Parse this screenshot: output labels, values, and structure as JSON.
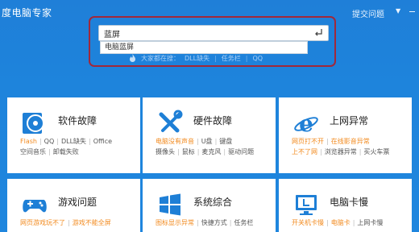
{
  "header": {
    "app_title": "度电脑专家",
    "feedback": "提交问题",
    "menu_arrow": "▼"
  },
  "search": {
    "value": "蓝屏",
    "suggestion": "电脑蓝屏",
    "hot_label": "大家都在搜：",
    "hot_items": [
      "DLL缺失",
      "任务栏",
      "QQ"
    ]
  },
  "cards": [
    {
      "title": "软件故障",
      "icon": "disc-icon",
      "lines": [
        [
          {
            "t": "Flash",
            "hot": true
          },
          {
            "t": "QQ"
          },
          {
            "t": "DLL缺失"
          },
          {
            "t": "Office"
          }
        ],
        [
          {
            "t": "空间音乐"
          },
          {
            "t": "卸载失败"
          }
        ]
      ]
    },
    {
      "title": "硬件故障",
      "icon": "tools-icon",
      "lines": [
        [
          {
            "t": "电脑没有声音",
            "hot": true
          },
          {
            "t": "U盘"
          },
          {
            "t": "键盘"
          }
        ],
        [
          {
            "t": "摄像头"
          },
          {
            "t": "鼠标"
          },
          {
            "t": "麦克风"
          },
          {
            "t": "驱动问题"
          }
        ]
      ]
    },
    {
      "title": "上网异常",
      "icon": "ie-icon",
      "lines": [
        [
          {
            "t": "网页打不开",
            "hot": true
          },
          {
            "t": "在线影音异常",
            "hot": true
          }
        ],
        [
          {
            "t": "上不了网",
            "hot": true
          },
          {
            "t": "浏览器异常"
          },
          {
            "t": "买火车票"
          }
        ]
      ]
    },
    {
      "title": "游戏问题",
      "icon": "gamepad-icon",
      "lines": [
        [
          {
            "t": "网页游戏玩不了",
            "hot": true
          },
          {
            "t": "游戏不能全屏",
            "hot": true
          }
        ]
      ]
    },
    {
      "title": "系统综合",
      "icon": "windows-icon",
      "lines": [
        [
          {
            "t": "图标显示异常",
            "hot": true
          },
          {
            "t": "快捷方式"
          },
          {
            "t": "任务栏"
          }
        ]
      ]
    },
    {
      "title": "电脑卡慢",
      "icon": "monitor-icon",
      "lines": [
        [
          {
            "t": "开关机卡慢",
            "hot": true
          },
          {
            "t": "电脑卡",
            "hot": true
          },
          {
            "t": "上网卡慢"
          }
        ]
      ]
    }
  ]
}
